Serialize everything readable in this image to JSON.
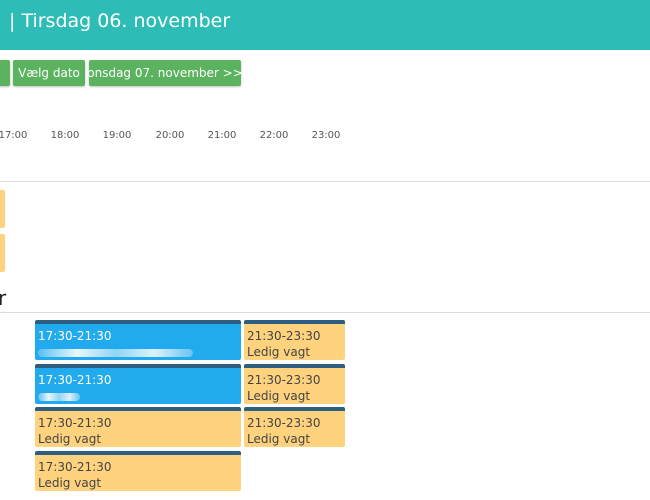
{
  "header": {
    "title": "| Tirsdag 06. november"
  },
  "nav": {
    "choose_date": "Vælg dato",
    "next_day": "onsdag 07. november >>"
  },
  "timeline": {
    "hours": [
      "17:00",
      "18:00",
      "19:00",
      "20:00",
      "21:00",
      "22:00",
      "23:00"
    ]
  },
  "section": {
    "title_tail": "r"
  },
  "shifts": [
    {
      "time": "17:30-21:30",
      "label": "",
      "status": "taken"
    },
    {
      "time": "21:30-23:30",
      "label": "Ledig vagt",
      "status": "open"
    },
    {
      "time": "17:30-21:30",
      "label": "",
      "status": "taken"
    },
    {
      "time": "21:30-23:30",
      "label": "Ledig vagt",
      "status": "open"
    },
    {
      "time": "17:30-21:30",
      "label": "Ledig vagt",
      "status": "open"
    },
    {
      "time": "21:30-23:30",
      "label": "Ledig vagt",
      "status": "open"
    },
    {
      "time": "17:30-21:30",
      "label": "Ledig vagt",
      "status": "open"
    }
  ],
  "colors": {
    "header": "#2dbdb6",
    "button": "#5cb35f",
    "taken_shift": "#22aaee",
    "open_shift": "#ffd27e",
    "shift_border": "#2f5f80"
  }
}
